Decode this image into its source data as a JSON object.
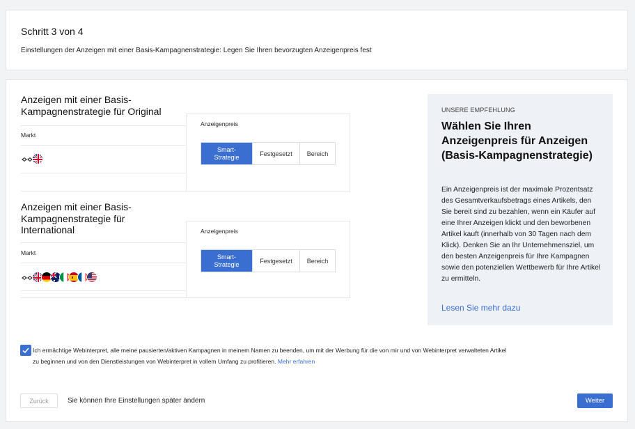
{
  "step": {
    "title": "Schritt 3 von 4",
    "description": "Einstellungen der Anzeigen mit einer Basis-Kampagnenstrategie: Legen Sie Ihren bevorzugten Anzeigenpreis fest"
  },
  "sections": [
    {
      "title": "Anzeigen mit einer Basis-Kampagnenstrategie für Original",
      "market_label": "Markt",
      "flags": [
        "logo-flag-icon",
        "uk-flag-icon"
      ],
      "price_label": "Anzeigenpreis",
      "options": [
        "Smart-Strategie",
        "Festgesetzt",
        "Bereich"
      ],
      "selected": "Smart-Strategie"
    },
    {
      "title": "Anzeigen mit einer Basis-Kampagnenstrategie für International",
      "market_label": "Markt",
      "flags": [
        "logo-flag-icon",
        "uk-flag-icon",
        "germany-flag-icon",
        "australia-flag-icon",
        "italy-flag-icon",
        "spain-flag-icon",
        "france-flag-icon",
        "usa-flag-icon"
      ],
      "price_label": "Anzeigenpreis",
      "options": [
        "Smart-Strategie",
        "Festgesetzt",
        "Bereich"
      ],
      "selected": "Smart-Strategie"
    }
  ],
  "recommendation": {
    "kicker": "UNSERE EMPFEHLUNG",
    "heading": "Wählen Sie Ihren Anzeigenpreis für Anzeigen (Basis-Kampagnenstrategie)",
    "body": "Ein Anzeigenpreis ist der maximale Prozentsatz des Gesamtverkaufsbetrags eines Artikels, den Sie bereit sind zu bezahlen, wenn ein Käufer auf eine Ihrer Anzeigen klickt und den beworbenen Artikel kauft (innerhalb von 30 Tagen nach dem Klick). Denken Sie an Ihr Unternehmensziel, um den besten Anzeigenpreis für Ihre Kampagnen sowie den potenziellen Wettbewerb für Ihre Artikel zu ermitteln.",
    "link": "Lesen Sie mehr dazu"
  },
  "consent": {
    "checked": true,
    "text": "Ich ermächtige Webinterpret, alle meine pausierten/aktiven Kampagnen in meinem Namen zu beenden, um mit der Werbung für die von mir und von Webinterpret verwalteten Artikel zu beginnen und von den Dienstleistungen von Webinterpret in vollem Umfang zu profitieren.",
    "link": "Mehr erfahren"
  },
  "footer": {
    "back_label": "Zurück",
    "note": "Sie können Ihre Einstellungen später ändern",
    "next_label": "Weiter"
  },
  "colors": {
    "accent": "#3a6fd1",
    "panel": "#eef1f6"
  }
}
